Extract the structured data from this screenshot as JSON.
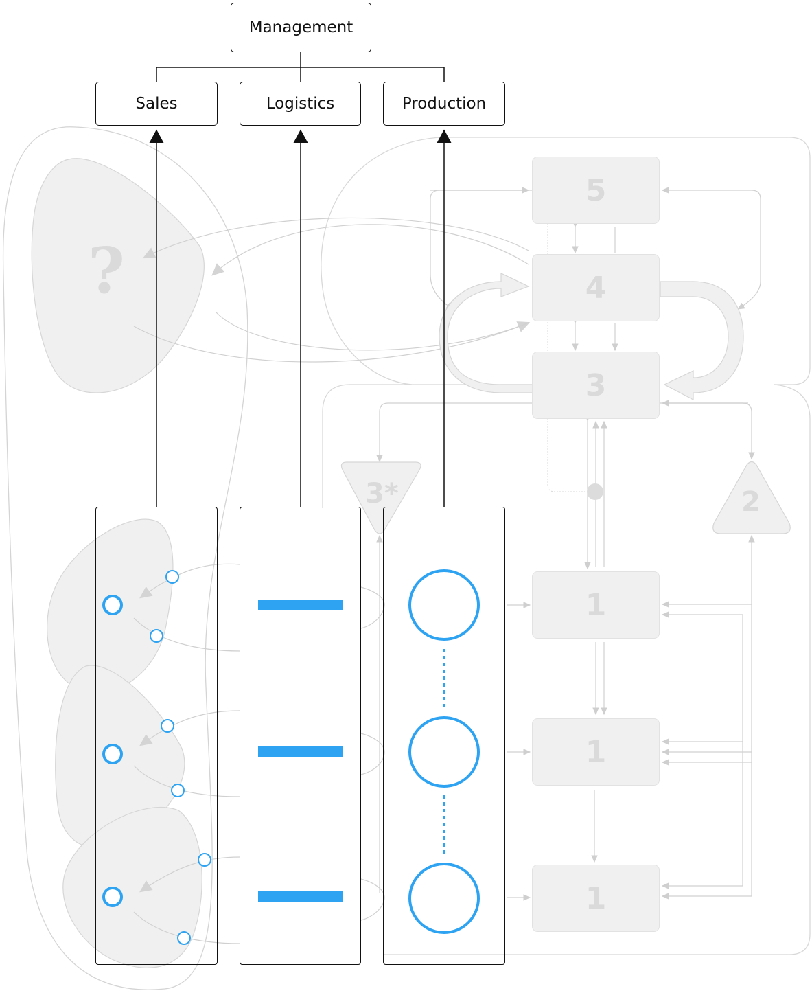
{
  "org_chart": {
    "root": "Management",
    "departments": [
      "Sales",
      "Logistics",
      "Production"
    ]
  },
  "vsm_systems": {
    "system5": "5",
    "system4": "4",
    "system3": "3",
    "system3_star": "3*",
    "system2": "2",
    "system1_units": [
      "1",
      "1",
      "1"
    ],
    "environment": "?"
  },
  "colors": {
    "accent": "#2ea3f2",
    "outline": "#111111",
    "ghost_fill": "#f0f0f0",
    "ghost_line": "#d0d0d0",
    "ghost_text": "#dadada"
  }
}
